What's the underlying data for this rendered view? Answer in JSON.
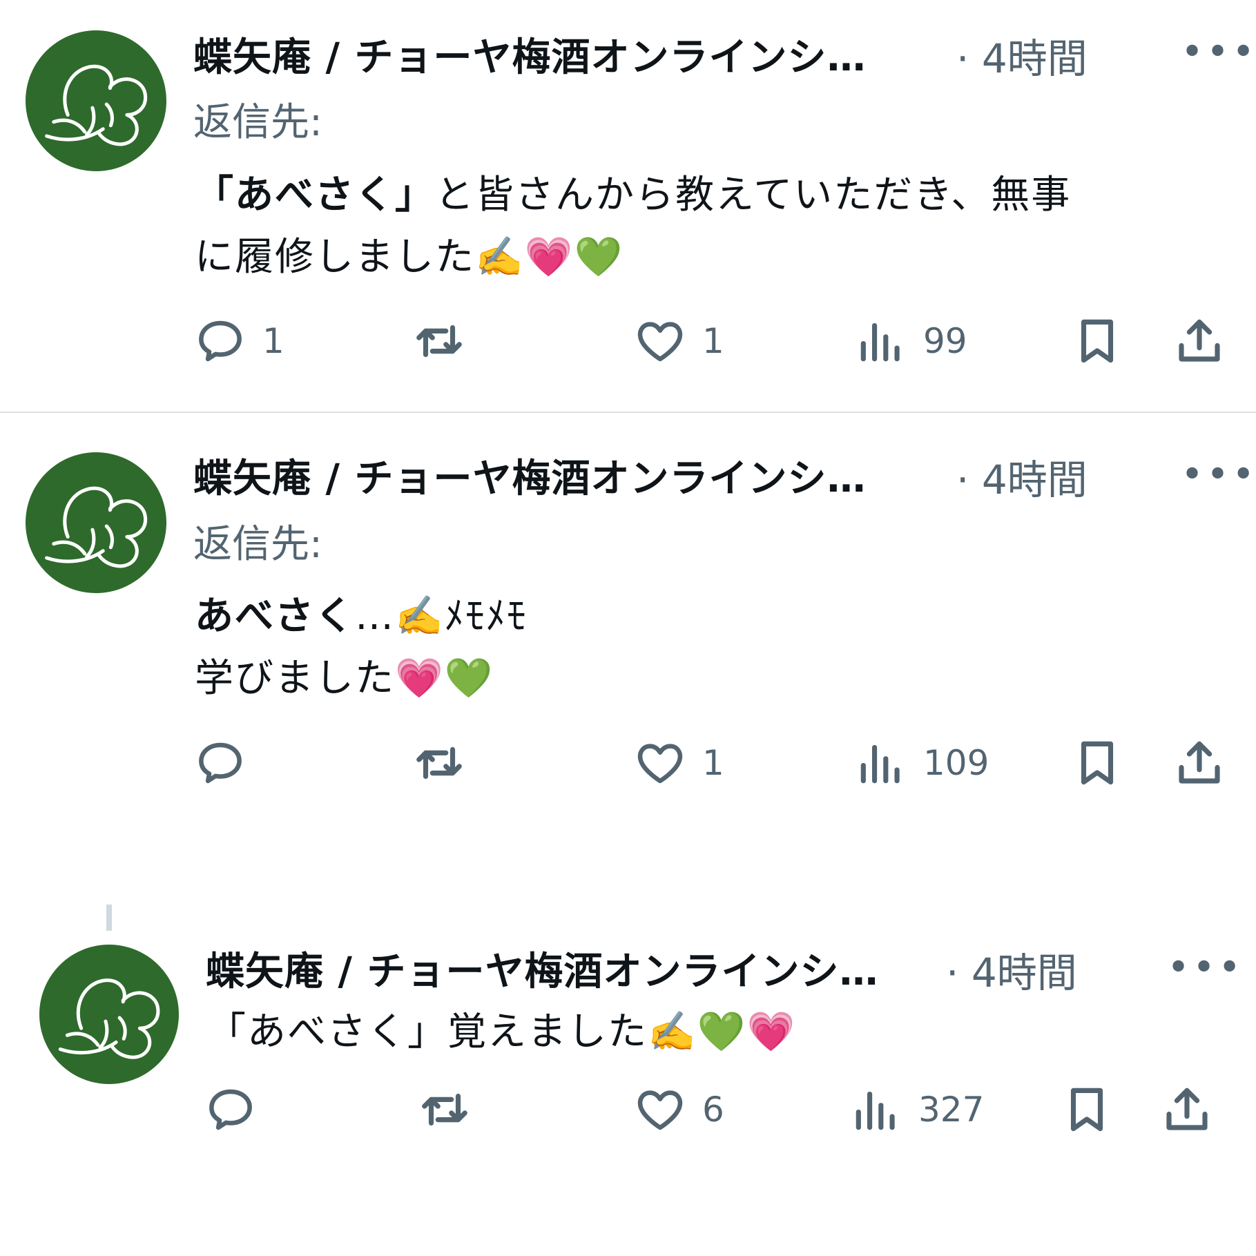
{
  "colors": {
    "avatar_bg": "#2e6a2c",
    "secondary_text": "#536471",
    "primary_text": "#0f1419"
  },
  "tweets": [
    {
      "author": "蝶矢庵 / チョーヤ梅酒オンラインシ…",
      "time": "· 4時間",
      "reply_label": "返信先:",
      "body_bold": "「あべさく」",
      "body_rest": "と皆さんから教えていただき、無事\nに履修しました✍️💗💚",
      "actions": {
        "reply": "1",
        "retweet": "",
        "like": "1",
        "views": "99"
      }
    },
    {
      "author": "蝶矢庵 / チョーヤ梅酒オンラインシ…",
      "time": "· 4時間",
      "reply_label": "返信先:",
      "body_bold": "あべさく",
      "body_rest": "…✍️ﾒﾓﾒﾓ\n学びました💗💚",
      "actions": {
        "reply": "",
        "retweet": "",
        "like": "1",
        "views": "109"
      }
    },
    {
      "author": "蝶矢庵 / チョーヤ梅酒オンラインシ…",
      "time": "· 4時間",
      "body": "「あべさく」覚えました✍️💚💗",
      "actions": {
        "reply": "",
        "retweet": "",
        "like": "6",
        "views": "327"
      }
    }
  ],
  "icons": {
    "reply": "reply-bubble-icon",
    "retweet": "retweet-icon",
    "like": "heart-icon",
    "views": "views-bar-icon",
    "bookmark": "bookmark-icon",
    "share": "share-icon",
    "more": "more-dots-icon",
    "avatar": "butterfly-logo"
  }
}
